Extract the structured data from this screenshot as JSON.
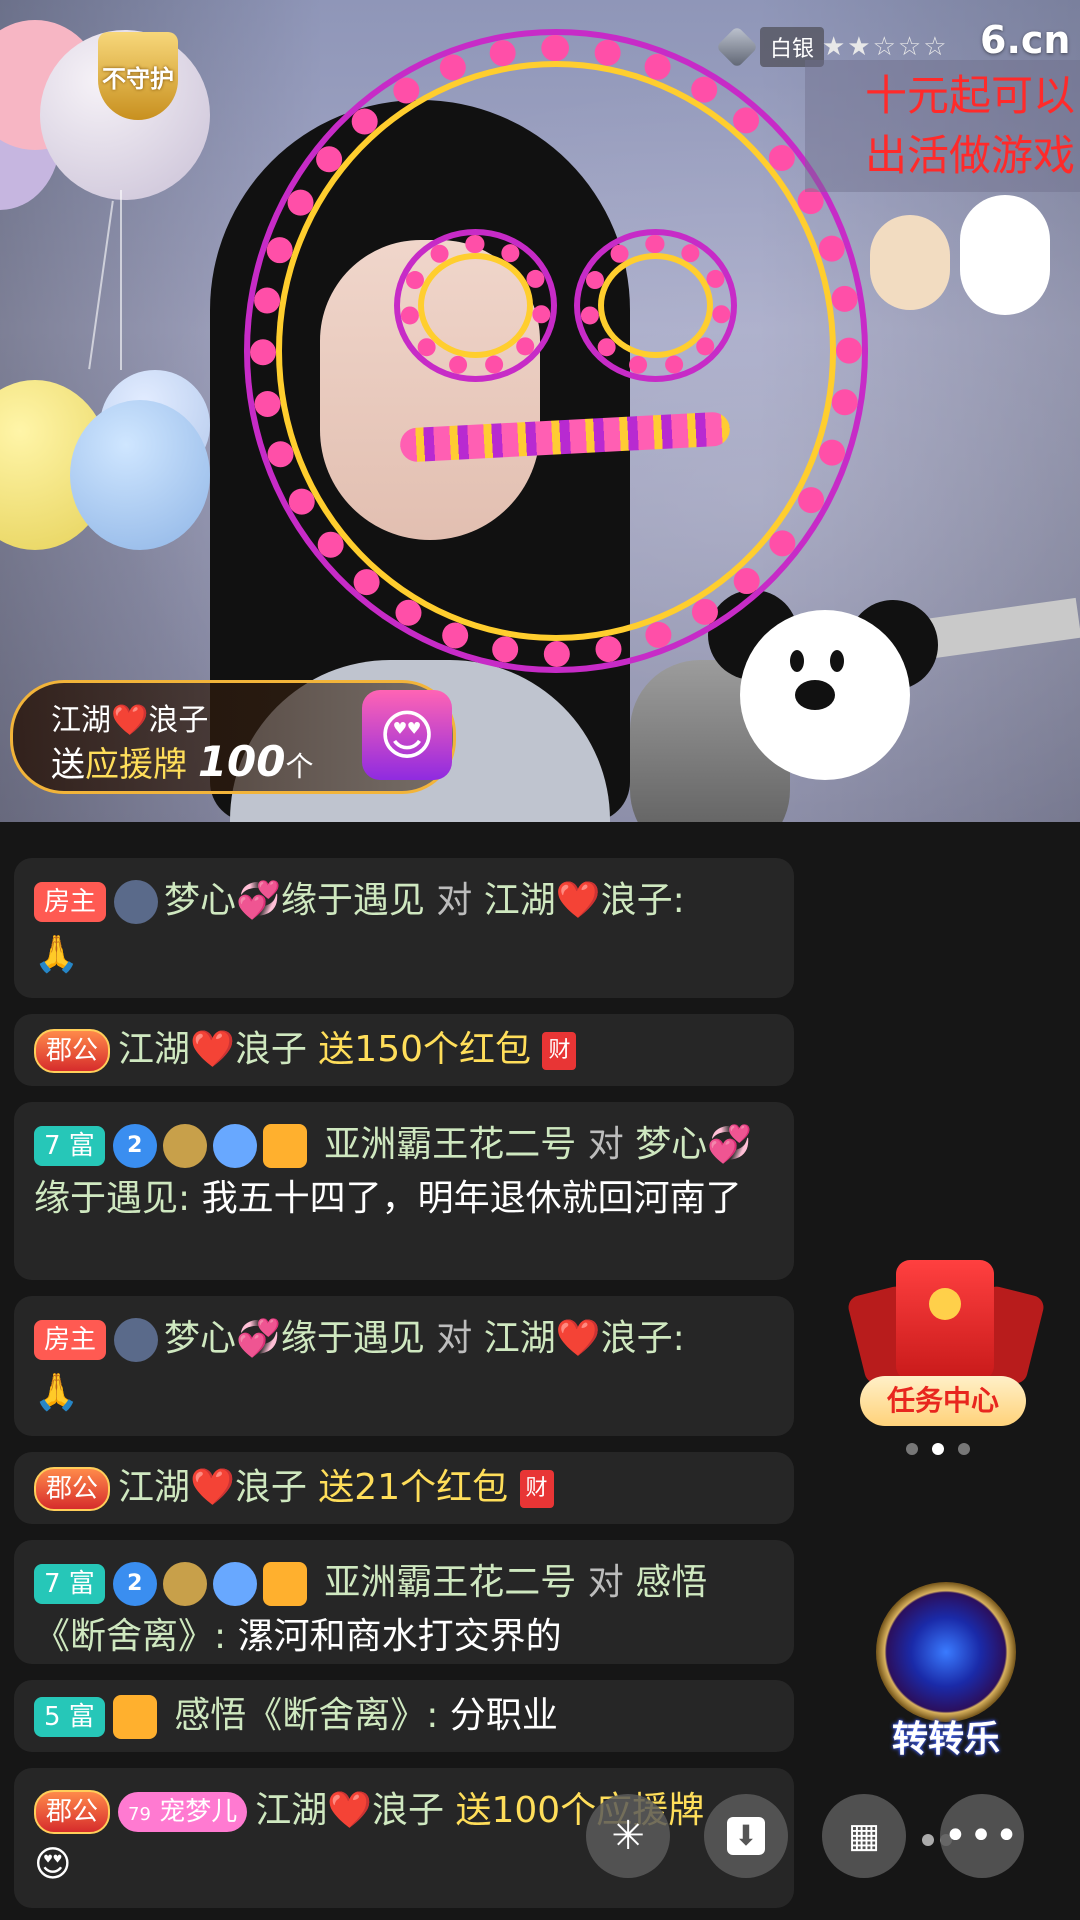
{
  "stream": {
    "guard_badge": "不守护",
    "level_label": "白银",
    "level_stars": "★★☆☆☆",
    "brand": "6.cn",
    "notice": "十元起可以\n出活做游戏"
  },
  "gift_toast": {
    "sender": "江湖❤️浪子",
    "verb": "送",
    "gift_name": "应援牌",
    "count": "100",
    "unit": "个",
    "gift_icon": "😍"
  },
  "messages": [
    {
      "tag": "房主",
      "sender": "梦心💞缘于遇见",
      "verb": "对",
      "target": "江湖❤️浪子:",
      "content": "🙏"
    },
    {
      "tag": "郡公",
      "sender": "江湖❤️浪子",
      "gift_text": "送150个红包",
      "hb": "财"
    },
    {
      "tag": "7 富",
      "badge_level": "2",
      "sender": "亚洲霸王花二号",
      "verb": "对",
      "target": "梦心💞缘于遇见:",
      "content": "我五十四了，明年退休就回河南了"
    },
    {
      "tag": "房主",
      "sender": "梦心💞缘于遇见",
      "verb": "对",
      "target": "江湖❤️浪子:",
      "content": "🙏"
    },
    {
      "tag": "郡公",
      "sender": "江湖❤️浪子",
      "gift_text": "送21个红包",
      "hb": "财"
    },
    {
      "tag": "7 富",
      "badge_level": "2",
      "sender": "亚洲霸王花二号",
      "verb": "对",
      "target": "感悟《断舍离》:",
      "content": "漯河和商水打交界的"
    },
    {
      "tag": "5 富",
      "sender": "感悟《断舍离》:",
      "content": "分职业"
    },
    {
      "tag": "郡公",
      "pet_tag": "宠梦儿",
      "pet_level": "79",
      "sender": "江湖❤️浪子",
      "gift_text": "送100个应援牌",
      "gift_icon": "😍"
    }
  ],
  "widgets": {
    "task_center": "任务中心",
    "wheel": "转转乐"
  },
  "bottom_bar": {
    "icons": [
      "sparkle-icon",
      "download-icon",
      "grid-icon",
      "more-icon"
    ]
  },
  "colors": {
    "chat_bg": "#161616",
    "bubble_bg": "#262626",
    "name_green": "#cfe8c0",
    "gift_gold": "#ffde5a",
    "host_red": "#ff5a52",
    "rich_teal": "#26c7b8"
  }
}
